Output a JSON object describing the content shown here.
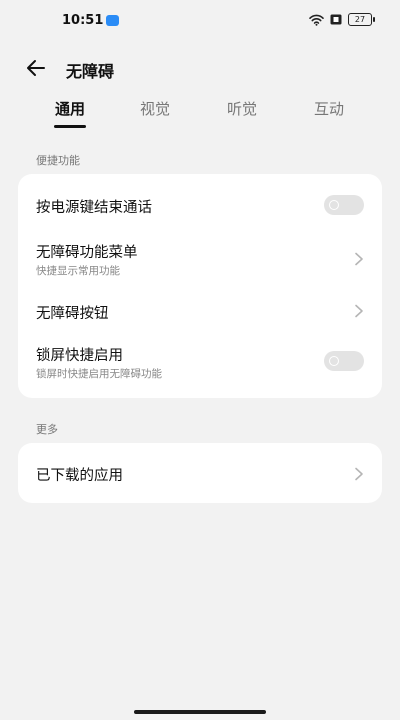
{
  "status_bar": {
    "time": "10:51",
    "battery": "27"
  },
  "app_bar": {
    "title": "无障碍"
  },
  "tabs": [
    {
      "label": "通用",
      "active": true
    },
    {
      "label": "视觉",
      "active": false
    },
    {
      "label": "听觉",
      "active": false
    },
    {
      "label": "互动",
      "active": false
    }
  ],
  "sections": {
    "shortcuts": {
      "label": "便捷功能",
      "items": [
        {
          "title": "按电源键结束通话",
          "control": "toggle",
          "on": false
        },
        {
          "title": "无障碍功能菜单",
          "subtitle": "快捷显示常用功能",
          "control": "chevron"
        },
        {
          "title": "无障碍按钮",
          "control": "chevron"
        },
        {
          "title": "锁屏快捷启用",
          "subtitle": "锁屏时快捷启用无障碍功能",
          "control": "toggle",
          "on": false
        }
      ]
    },
    "more": {
      "label": "更多",
      "items": [
        {
          "title": "已下载的应用",
          "control": "chevron"
        }
      ]
    }
  },
  "colors": {
    "background": "#f2f2f2",
    "card": "#ffffff",
    "toggle_off": "#e3e3e3",
    "status_app_icon": "#2b8cf6"
  },
  "icons": {
    "back": "arrow-left-icon",
    "chevron": "chevron-right-icon",
    "wifi": "wifi-icon",
    "sim": "sim-card-icon",
    "battery": "battery-icon"
  }
}
